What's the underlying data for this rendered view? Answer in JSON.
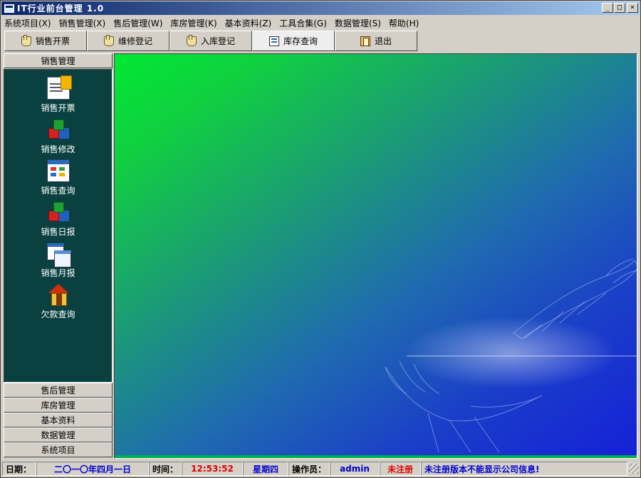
{
  "window": {
    "title": "IT行业前台管理 1.0",
    "min_label": "_",
    "max_label": "□",
    "close_label": "×"
  },
  "menu": [
    {
      "label": "系统项目(X)"
    },
    {
      "label": "销售管理(X)"
    },
    {
      "label": "售后管理(W)"
    },
    {
      "label": "库房管理(K)"
    },
    {
      "label": "基本资料(Z)"
    },
    {
      "label": "工具合集(G)"
    },
    {
      "label": "数据管理(S)"
    },
    {
      "label": "帮助(H)"
    }
  ],
  "toolbar": [
    {
      "label": "销售开票",
      "icon": "hand-icon"
    },
    {
      "label": "维修登记",
      "icon": "hand-icon"
    },
    {
      "label": "入库登记",
      "icon": "hand-icon"
    },
    {
      "label": "库存查询",
      "icon": "grid-icon",
      "active": true
    },
    {
      "label": "退出",
      "icon": "door-icon"
    }
  ],
  "sidebar": {
    "active_group": "销售管理",
    "entries": [
      {
        "label": "销售开票",
        "icon": "clipboard-icon"
      },
      {
        "label": "销售修改",
        "icon": "cubes-icon"
      },
      {
        "label": "销售查询",
        "icon": "window-icon"
      },
      {
        "label": "销售日报",
        "icon": "cubes-icon"
      },
      {
        "label": "销售月报",
        "icon": "windows-icon"
      },
      {
        "label": "欠款查询",
        "icon": "house-icon"
      }
    ],
    "groups": [
      "售后管理",
      "库房管理",
      "基本资料",
      "数据管理",
      "系统项目"
    ]
  },
  "status": {
    "date_label": "日期：",
    "date_value": "二〇一〇年四月一日",
    "time_label": "时间：",
    "time_value": "12:53:52",
    "weekday": "星期四",
    "operator_label": "操作员：",
    "operator_value": "admin",
    "reg_status": "未注册",
    "notice": "未注册版本不能显示公司信息!"
  },
  "colors": {
    "title_gradient_start": "#0a246a",
    "sidebar_panel": "#0a4040",
    "status_blue": "#0000cc",
    "status_red": "#e00000"
  }
}
